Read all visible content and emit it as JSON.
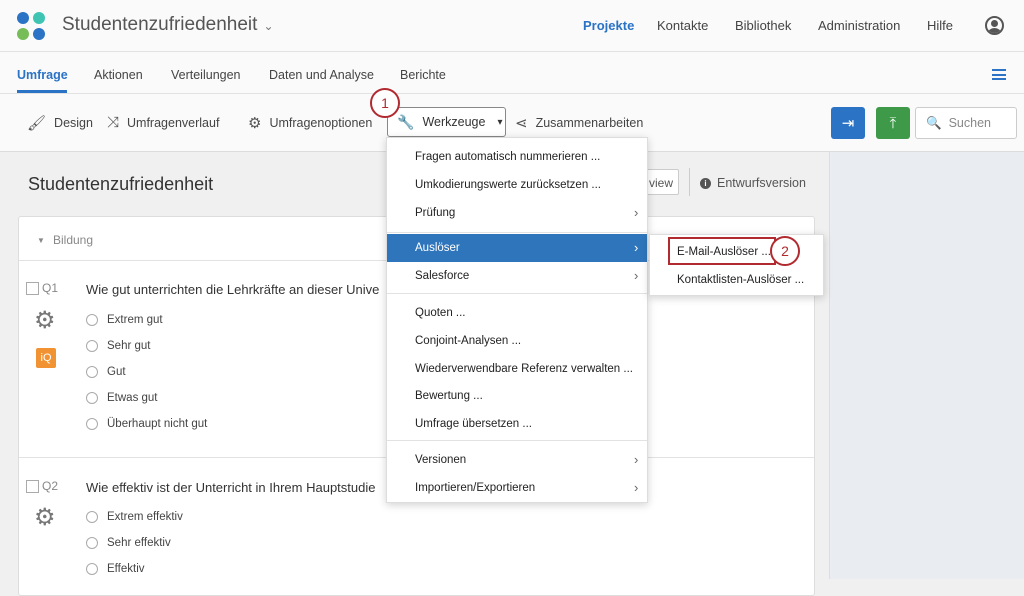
{
  "app": {
    "title": "Studentenzufriedenheit",
    "logo_colors": [
      "#2a73c5",
      "#3fc4b4",
      "#76bd58",
      "#2a73c5"
    ]
  },
  "topnav": {
    "items": [
      {
        "label": "Projekte",
        "active": true
      },
      {
        "label": "Kontakte"
      },
      {
        "label": "Bibliothek"
      },
      {
        "label": "Administration"
      },
      {
        "label": "Hilfe"
      }
    ],
    "user_icon": "user-circle-icon"
  },
  "tabs": {
    "items": [
      {
        "label": "Umfrage",
        "active": true
      },
      {
        "label": "Aktionen"
      },
      {
        "label": "Verteilungen"
      },
      {
        "label": "Daten und Analyse"
      },
      {
        "label": "Berichte"
      }
    ],
    "list_icon": "list-icon"
  },
  "toolbar": {
    "design": "Design",
    "umfragenverlauf": "Umfragenverlauf",
    "umfragenoptionen": "Umfragenoptionen",
    "werkzeuge": "Werkzeuge",
    "zusammenarbeiten": "Zusammenarbeiten",
    "search_placeholder": "Suchen",
    "preview_color": "#2a73c5",
    "publish_color": "#3e9a48"
  },
  "callouts": {
    "one": "1",
    "two": "2",
    "color": "#b02a30"
  },
  "editor": {
    "title": "Studentenzufriedenheit",
    "preview_label": "view",
    "draft_label": "Entwurfsversion",
    "block_label": "Bildung"
  },
  "questions": [
    {
      "number": "Q1",
      "text": "Wie gut unterrichten die Lehrkräfte an dieser Unive",
      "options": [
        "Extrem gut",
        "Sehr gut",
        "Gut",
        "Etwas gut",
        "Überhaupt nicht gut"
      ],
      "iq_badge": "iQ"
    },
    {
      "number": "Q2",
      "text": "Wie effektiv ist der Unterricht in Ihrem Hauptstudie",
      "options": [
        "Extrem effektiv",
        "Sehr effektiv",
        "Effektiv"
      ]
    }
  ],
  "menu": {
    "items": [
      "Fragen automatisch nummerieren ...",
      "Umkodierungswerte zurücksetzen ...",
      "Prüfung",
      "Auslöser",
      "Salesforce",
      "Quoten ...",
      "Conjoint-Analysen ...",
      "Wiederverwendbare Referenz verwalten ...",
      "Bewertung ...",
      "Umfrage übersetzen ...",
      "Versionen",
      "Importieren/Exportieren"
    ],
    "active_index": 3,
    "active_color": "#2f75bb"
  },
  "submenu": {
    "items": [
      "E-Mail-Auslöser ...",
      "Kontaktlisten-Auslöser ..."
    ]
  }
}
